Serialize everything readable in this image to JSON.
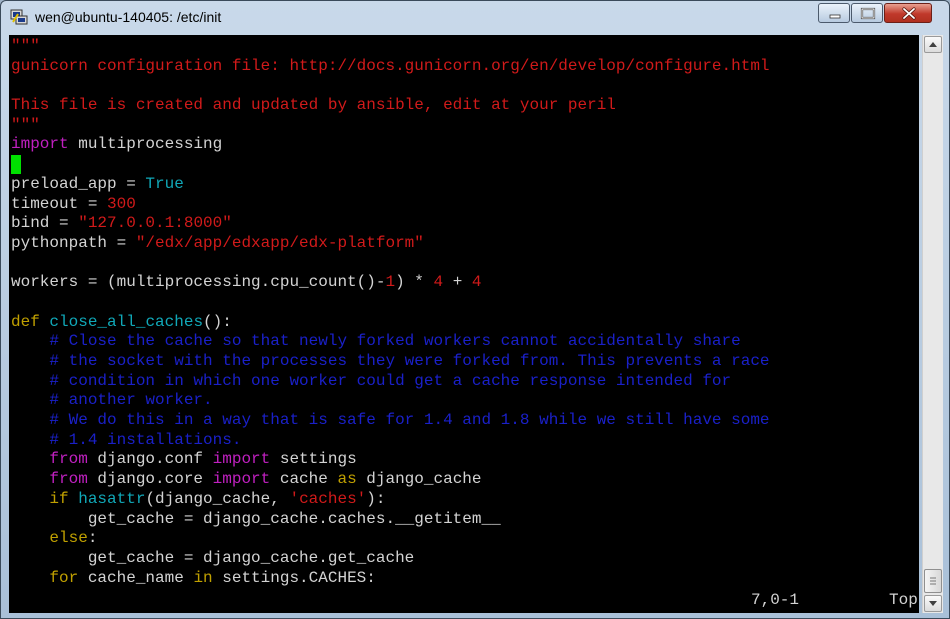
{
  "window": {
    "title": "wen@ubuntu-140405: /etc/init",
    "icons": {
      "app": "putty-icon",
      "minimize": "minimize-icon",
      "maximize": "maximize-icon",
      "close": "close-icon"
    }
  },
  "editor": {
    "lines": [
      [
        {
          "t": "\"\"\"",
          "c": "red"
        }
      ],
      [
        {
          "t": "gunicorn configuration file: http://docs.gunicorn.org/en/develop/configure.html",
          "c": "red"
        }
      ],
      [],
      [
        {
          "t": "This file is created and updated by ansible, edit at your peril",
          "c": "red"
        }
      ],
      [
        {
          "t": "\"\"\"",
          "c": "red"
        }
      ],
      [
        {
          "t": "import",
          "c": "mag"
        },
        {
          "t": " multiprocessing"
        }
      ],
      [
        {
          "cursor": true
        }
      ],
      [
        {
          "t": "preload_app = "
        },
        {
          "t": "True",
          "c": "cyn"
        }
      ],
      [
        {
          "t": "timeout = "
        },
        {
          "t": "300",
          "c": "red"
        }
      ],
      [
        {
          "t": "bind = "
        },
        {
          "t": "\"127.0.0.1:8000\"",
          "c": "red"
        }
      ],
      [
        {
          "t": "pythonpath = "
        },
        {
          "t": "\"/edx/app/edxapp/edx-platform\"",
          "c": "red"
        }
      ],
      [],
      [
        {
          "t": "workers = (multiprocessing.cpu_count()-"
        },
        {
          "t": "1",
          "c": "red"
        },
        {
          "t": ") * "
        },
        {
          "t": "4",
          "c": "red"
        },
        {
          "t": " + "
        },
        {
          "t": "4",
          "c": "red"
        }
      ],
      [],
      [
        {
          "t": "def",
          "c": "yel"
        },
        {
          "t": " "
        },
        {
          "t": "close_all_caches",
          "c": "cyn"
        },
        {
          "t": "():"
        }
      ],
      [
        {
          "t": "    # Close the cache so that newly forked workers cannot accidentally share",
          "c": "blu"
        }
      ],
      [
        {
          "t": "    # the socket with the processes they were forked from. This prevents a race",
          "c": "blu"
        }
      ],
      [
        {
          "t": "    # condition in which one worker could get a cache response intended for",
          "c": "blu"
        }
      ],
      [
        {
          "t": "    # another worker.",
          "c": "blu"
        }
      ],
      [
        {
          "t": "    # We do this in a way that is safe for 1.4 and 1.8 while we still have some",
          "c": "blu"
        }
      ],
      [
        {
          "t": "    # 1.4 installations.",
          "c": "blu"
        }
      ],
      [
        {
          "t": "    "
        },
        {
          "t": "from",
          "c": "mag"
        },
        {
          "t": " django.conf "
        },
        {
          "t": "import",
          "c": "mag"
        },
        {
          "t": " settings"
        }
      ],
      [
        {
          "t": "    "
        },
        {
          "t": "from",
          "c": "mag"
        },
        {
          "t": " django.core "
        },
        {
          "t": "import",
          "c": "mag"
        },
        {
          "t": " cache "
        },
        {
          "t": "as",
          "c": "yel"
        },
        {
          "t": " django_cache"
        }
      ],
      [
        {
          "t": "    "
        },
        {
          "t": "if",
          "c": "yel"
        },
        {
          "t": " "
        },
        {
          "t": "hasattr",
          "c": "cyn"
        },
        {
          "t": "(django_cache, "
        },
        {
          "t": "'caches'",
          "c": "red"
        },
        {
          "t": "):"
        }
      ],
      [
        {
          "t": "        get_cache = django_cache.caches.__getitem__"
        }
      ],
      [
        {
          "t": "    "
        },
        {
          "t": "else",
          "c": "yel"
        },
        {
          "t": ":"
        }
      ],
      [
        {
          "t": "        get_cache = django_cache.get_cache"
        }
      ],
      [
        {
          "t": "    "
        },
        {
          "t": "for",
          "c": "yel"
        },
        {
          "t": " cache_name "
        },
        {
          "t": "in",
          "c": "yel"
        },
        {
          "t": " settings.CACHES:"
        }
      ]
    ],
    "status": {
      "position": "7,0-1",
      "scroll": "Top"
    }
  },
  "colors": {
    "background": "#000000",
    "text": "#d3d3d3",
    "string_red": "#d11a1a",
    "keyword_magenta": "#c020c0",
    "builtin_cyan": "#10a8b8",
    "comment_blue": "#1a20c8",
    "statement_yellow": "#c0a000",
    "cursor_green": "#00e000"
  }
}
